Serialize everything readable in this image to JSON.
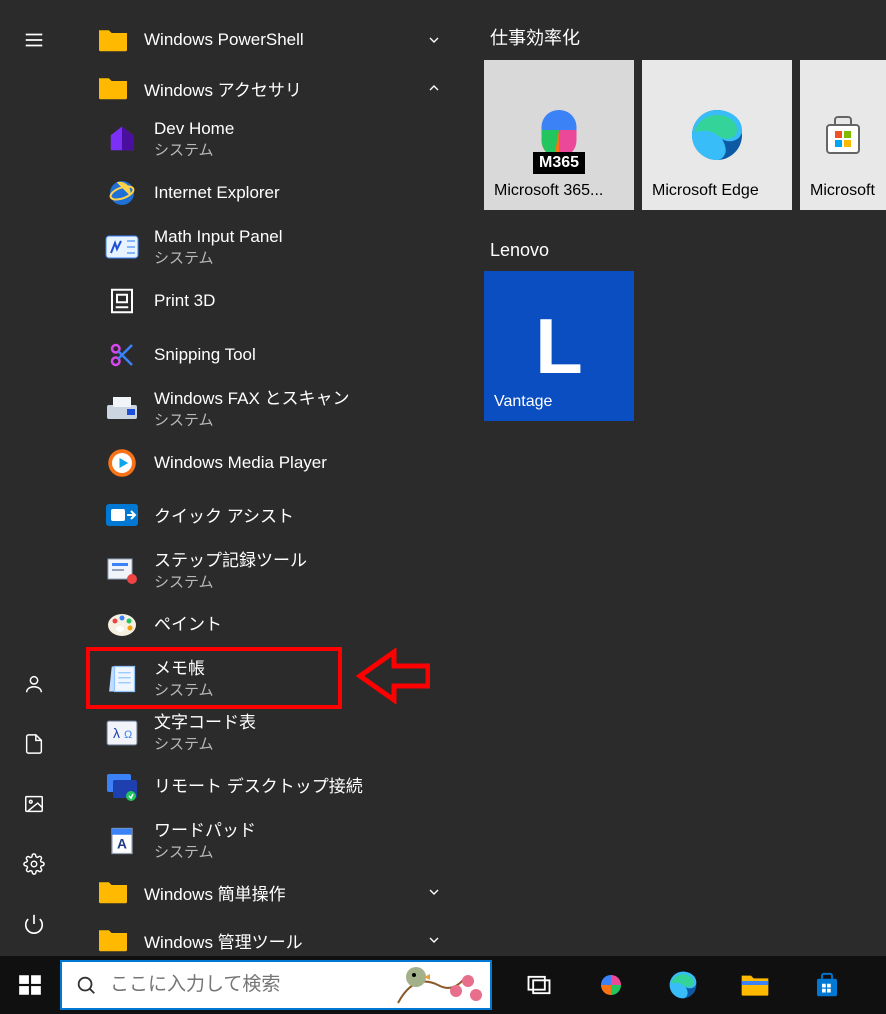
{
  "rail": {
    "menu": "menu",
    "account": "account",
    "documents": "documents",
    "pictures": "pictures",
    "settings": "settings",
    "power": "power"
  },
  "folders": {
    "powershell": {
      "label": "Windows PowerShell",
      "expanded": false
    },
    "accessories": {
      "label": "Windows アクセサリ",
      "expanded": true
    },
    "ease": {
      "label": "Windows 簡単操作",
      "expanded": false
    },
    "admin": {
      "label": "Windows 管理ツール",
      "expanded": false
    }
  },
  "accessories_items": [
    {
      "title": "Dev Home",
      "sub": "システム",
      "icon": "devhome"
    },
    {
      "title": "Internet Explorer",
      "sub": "",
      "icon": "ie"
    },
    {
      "title": "Math Input Panel",
      "sub": "システム",
      "icon": "math"
    },
    {
      "title": "Print 3D",
      "sub": "",
      "icon": "print3d"
    },
    {
      "title": "Snipping Tool",
      "sub": "",
      "icon": "snip"
    },
    {
      "title": "Windows FAX とスキャン",
      "sub": "システム",
      "icon": "fax"
    },
    {
      "title": "Windows Media Player",
      "sub": "",
      "icon": "wmp"
    },
    {
      "title": "クイック アシスト",
      "sub": "",
      "icon": "quickassist"
    },
    {
      "title": "ステップ記録ツール",
      "sub": "システム",
      "icon": "steps"
    },
    {
      "title": "ペイント",
      "sub": "",
      "icon": "paint"
    },
    {
      "title": "メモ帳",
      "sub": "システム",
      "icon": "notepad"
    },
    {
      "title": "文字コード表",
      "sub": "システム",
      "icon": "charmap"
    },
    {
      "title": "リモート デスクトップ接続",
      "sub": "",
      "icon": "rdp"
    },
    {
      "title": "ワードパッド",
      "sub": "システム",
      "icon": "wordpad"
    }
  ],
  "tiles": {
    "group1_title": "仕事効率化",
    "group1": [
      {
        "label": "Microsoft 365...",
        "icon": "m365"
      },
      {
        "label": "Microsoft Edge",
        "icon": "edge"
      },
      {
        "label": "Microsoft",
        "icon": "store"
      }
    ],
    "group2_title": "Lenovo",
    "group2": [
      {
        "label": "Vantage",
        "icon": "lenovo"
      }
    ]
  },
  "search": {
    "placeholder": "ここに入力して検索"
  },
  "annotation": {
    "highlight_target": "メモ帳",
    "arrow": "left-arrow"
  },
  "colors": {
    "background": "#2b2b2b",
    "taskbar": "#101010",
    "accent": "#0078d4",
    "folder": "#ffb900",
    "highlight": "#ff0000",
    "lenovo_tile": "#0a4ec2"
  }
}
